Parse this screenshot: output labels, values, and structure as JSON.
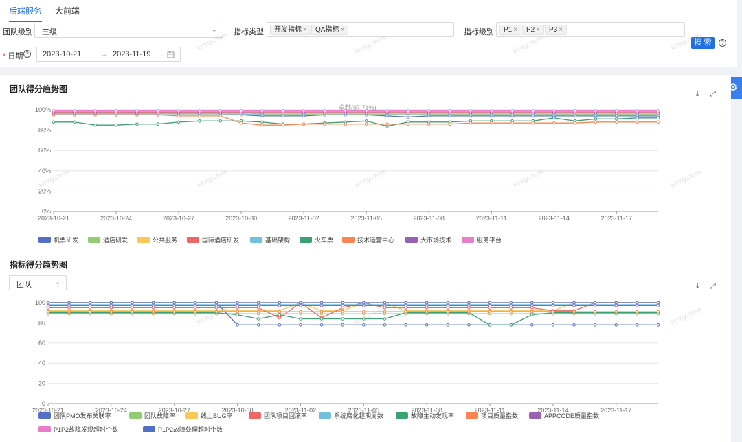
{
  "tabs": [
    {
      "label": "后端服务",
      "active": true
    },
    {
      "label": "大前端",
      "active": false
    }
  ],
  "filters": {
    "team_level": {
      "label": "团队级别:",
      "value": "三级"
    },
    "metric_type": {
      "label": "指标类型:",
      "tags": [
        "开发指标",
        "QA指标"
      ]
    },
    "metric_level": {
      "label": "指标级别:",
      "tags": [
        "P1",
        "P2",
        "P3"
      ]
    },
    "date": {
      "required_mark": "*",
      "label": "日期",
      "start": "2023-10-21",
      "separator": "→",
      "end": "2023-11-19"
    },
    "search_label": "搜 索"
  },
  "watermark_text": "jenny.chen",
  "colors": {
    "accent": "#1f6fe5"
  },
  "icons": {
    "download": "download-icon",
    "fullscreen": "fullscreen-icon",
    "settings": "gear-icon",
    "help": "help-icon",
    "calendar": "calendar-icon"
  },
  "charts": {
    "team": {
      "title": "团队得分趋势图"
    },
    "metric": {
      "title": "指标得分趋势图",
      "group_select": "团队"
    }
  },
  "chart_data": [
    {
      "type": "line",
      "title": "团队得分趋势图",
      "x": [
        "2023-10-21",
        "2023-10-22",
        "2023-10-23",
        "2023-10-24",
        "2023-10-25",
        "2023-10-26",
        "2023-10-27",
        "2023-10-28",
        "2023-10-29",
        "2023-10-30",
        "2023-10-31",
        "2023-11-01",
        "2023-11-02",
        "2023-11-03",
        "2023-11-04",
        "2023-11-05",
        "2023-11-06",
        "2023-11-07",
        "2023-11-08",
        "2023-11-09",
        "2023-11-10",
        "2023-11-11",
        "2023-11-12",
        "2023-11-13",
        "2023-11-14",
        "2023-11-15",
        "2023-11-16",
        "2023-11-17",
        "2023-11-18",
        "2023-11-19"
      ],
      "x_tick_labels": [
        "2023-10-21",
        "2023-10-24",
        "2023-10-27",
        "2023-10-30",
        "2023-11-02",
        "2023-11-05",
        "2023-11-08",
        "2023-11-11",
        "2023-11-14",
        "2023-11-17"
      ],
      "y_ticks": [
        "100%",
        "80%",
        "60%",
        "40%",
        "20%",
        "0%"
      ],
      "ylim": [
        0,
        100
      ],
      "legend_position": "bottom",
      "tooltip_label": "卓越(97.71%)",
      "series": [
        {
          "name": "机票研发",
          "color": "#5470c6",
          "values": [
            96,
            96,
            96,
            96,
            96,
            96,
            96,
            96,
            96,
            95,
            94,
            94,
            94,
            95,
            95,
            95,
            94,
            93,
            94,
            94,
            94,
            94,
            94,
            94,
            94,
            94,
            94,
            94,
            94,
            94
          ]
        },
        {
          "name": "酒店研发",
          "color": "#91cc75",
          "values": [
            97,
            97,
            97,
            97,
            97,
            97,
            97,
            97,
            97,
            97,
            96,
            96,
            96,
            96,
            96,
            96,
            96,
            96,
            96,
            96,
            96,
            96,
            96,
            96,
            96,
            96,
            96,
            96,
            96,
            96
          ]
        },
        {
          "name": "公共服务",
          "color": "#fac858",
          "values": [
            95,
            95,
            95,
            95,
            95,
            95,
            95,
            95,
            95,
            95,
            95,
            95,
            95,
            95,
            95,
            95,
            95,
            95,
            95,
            95,
            95,
            95,
            95,
            95,
            95,
            95,
            95,
            95,
            95,
            95
          ]
        },
        {
          "name": "国际酒店研发",
          "color": "#ee6666",
          "values": [
            98,
            98,
            98,
            98,
            98,
            98,
            98,
            98,
            98,
            98,
            98,
            98,
            98,
            98,
            98,
            98,
            98,
            98,
            98,
            98,
            98,
            98,
            98,
            98,
            98,
            98,
            98,
            98,
            98,
            98
          ]
        },
        {
          "name": "基础架构",
          "color": "#73c0de",
          "values": [
            96,
            96,
            96,
            96,
            96,
            96,
            96,
            96,
            96,
            96,
            95,
            95,
            95,
            95,
            95,
            95,
            95,
            95,
            95,
            95,
            95,
            95,
            95,
            95,
            95,
            95,
            95,
            95,
            95,
            95
          ]
        },
        {
          "name": "火车票",
          "color": "#3ba272",
          "values": [
            88,
            88,
            85,
            85,
            86,
            86,
            88,
            89,
            89,
            89,
            88,
            86,
            86,
            87,
            88,
            89,
            84,
            88,
            88,
            88,
            89,
            89,
            89,
            89,
            92,
            89,
            91,
            91,
            92,
            92
          ]
        },
        {
          "name": "技术运营中心",
          "color": "#fc8452",
          "values": [
            95,
            95,
            95,
            95,
            95,
            95,
            94,
            94,
            94,
            87,
            85,
            85,
            86,
            86,
            86,
            86,
            86,
            86,
            86,
            86,
            87,
            87,
            87,
            87,
            87,
            87,
            88,
            88,
            88,
            88
          ]
        },
        {
          "name": "大市场技术",
          "color": "#9a60b4",
          "values": [
            97,
            97,
            97,
            97,
            97,
            97,
            97,
            97,
            97,
            97,
            97,
            97,
            97,
            97,
            97,
            97,
            97,
            97,
            97,
            97,
            97,
            97,
            97,
            97,
            97,
            97,
            97,
            97,
            97,
            97
          ]
        },
        {
          "name": "服务平台",
          "color": "#ea7ccc",
          "values": [
            99,
            99,
            99,
            99,
            99,
            99,
            99,
            99,
            99,
            99,
            99,
            99,
            99,
            99,
            99,
            99,
            99,
            99,
            99,
            99,
            99,
            99,
            99,
            99,
            99,
            99,
            99,
            99,
            99,
            99
          ]
        }
      ]
    },
    {
      "type": "line",
      "title": "指标得分趋势图",
      "x": [
        "2023-10-21",
        "2023-10-22",
        "2023-10-23",
        "2023-10-24",
        "2023-10-25",
        "2023-10-26",
        "2023-10-27",
        "2023-10-28",
        "2023-10-29",
        "2023-10-30",
        "2023-10-31",
        "2023-11-01",
        "2023-11-02",
        "2023-11-03",
        "2023-11-04",
        "2023-11-05",
        "2023-11-06",
        "2023-11-07",
        "2023-11-08",
        "2023-11-09",
        "2023-11-10",
        "2023-11-11",
        "2023-11-12",
        "2023-11-13",
        "2023-11-14",
        "2023-11-15",
        "2023-11-16",
        "2023-11-17",
        "2023-11-18",
        "2023-11-19"
      ],
      "x_tick_labels": [
        "2023-10-21",
        "2023-10-24",
        "2023-10-27",
        "2023-10-30",
        "2023-11-02",
        "2023-11-05",
        "2023-11-08",
        "2023-11-11",
        "2023-11-14",
        "2023-11-17"
      ],
      "y_ticks": [
        "100",
        "80",
        "60",
        "40",
        "20",
        "0"
      ],
      "ylim": [
        0,
        100
      ],
      "legend_position": "bottom",
      "series": [
        {
          "name": "团队PMO发布关联率",
          "color": "#5470c6",
          "values": [
            100,
            100,
            100,
            100,
            100,
            100,
            100,
            100,
            100,
            78,
            78,
            78,
            78,
            78,
            78,
            78,
            78,
            78,
            78,
            78,
            78,
            78,
            78,
            78,
            78,
            78,
            78,
            78,
            78,
            78
          ]
        },
        {
          "name": "团队故障率",
          "color": "#91cc75",
          "values": [
            89,
            89,
            89,
            89,
            89,
            89,
            89,
            89,
            89,
            89,
            89,
            89,
            89,
            89,
            89,
            89,
            89,
            89,
            89,
            89,
            89,
            89,
            89,
            89,
            89,
            89,
            89,
            89,
            89,
            89
          ]
        },
        {
          "name": "线上BUG率",
          "color": "#fac858",
          "values": [
            92,
            92,
            92,
            92,
            92,
            92,
            92,
            92,
            92,
            92,
            92,
            92,
            100,
            92,
            92,
            100,
            100,
            92,
            92,
            92,
            92,
            92,
            92,
            92,
            92,
            100,
            100,
            100,
            100,
            100
          ]
        },
        {
          "name": "团队项目回滚率",
          "color": "#ee6666",
          "values": [
            95,
            95,
            95,
            95,
            95,
            95,
            95,
            95,
            95,
            95,
            95,
            85,
            100,
            85,
            95,
            100,
            95,
            95,
            95,
            95,
            95,
            95,
            95,
            95,
            92,
            92,
            100,
            100,
            100,
            100
          ]
        },
        {
          "name": "系统腐化超期周数",
          "color": "#73c0de",
          "values": [
            98,
            98,
            98,
            98,
            98,
            98,
            98,
            98,
            98,
            98,
            98,
            98,
            98,
            98,
            98,
            98,
            98,
            98,
            98,
            98,
            98,
            98,
            98,
            98,
            98,
            98,
            98,
            98,
            98,
            98
          ]
        },
        {
          "name": "故障主动发现率",
          "color": "#3ba272",
          "values": [
            90,
            90,
            90,
            90,
            90,
            90,
            90,
            90,
            90,
            88,
            84,
            88,
            84,
            84,
            84,
            84,
            84,
            90,
            90,
            90,
            90,
            78,
            78,
            88,
            90,
            90,
            90,
            90,
            90,
            90
          ]
        },
        {
          "name": "项目质量指数",
          "color": "#fc8452",
          "values": [
            91,
            91,
            91,
            91,
            91,
            91,
            91,
            91,
            91,
            91,
            91,
            91,
            91,
            91,
            91,
            91,
            91,
            91,
            91,
            91,
            91,
            91,
            91,
            91,
            91,
            91,
            91,
            91,
            91,
            91
          ]
        },
        {
          "name": "APPCODE质量指数",
          "color": "#9a60b4",
          "values": [
            97,
            97,
            97,
            97,
            97,
            97,
            97,
            97,
            97,
            97,
            97,
            97,
            97,
            97,
            97,
            97,
            97,
            97,
            97,
            97,
            97,
            97,
            97,
            97,
            97,
            97,
            97,
            97,
            97,
            97
          ]
        },
        {
          "name": "P1P2故障发现超时个数",
          "color": "#ea7ccc",
          "values": [
            100,
            100,
            100,
            100,
            100,
            100,
            100,
            100,
            100,
            100,
            100,
            100,
            100,
            100,
            100,
            100,
            100,
            100,
            100,
            100,
            100,
            100,
            100,
            100,
            100,
            100,
            100,
            100,
            100,
            100
          ]
        },
        {
          "name": "P1P2故障处理超时个数",
          "color": "#5470c6",
          "values": [
            100,
            100,
            100,
            100,
            100,
            100,
            100,
            100,
            100,
            100,
            100,
            100,
            100,
            100,
            100,
            100,
            100,
            100,
            100,
            100,
            100,
            100,
            100,
            100,
            100,
            100,
            100,
            100,
            100,
            100
          ]
        }
      ]
    }
  ]
}
